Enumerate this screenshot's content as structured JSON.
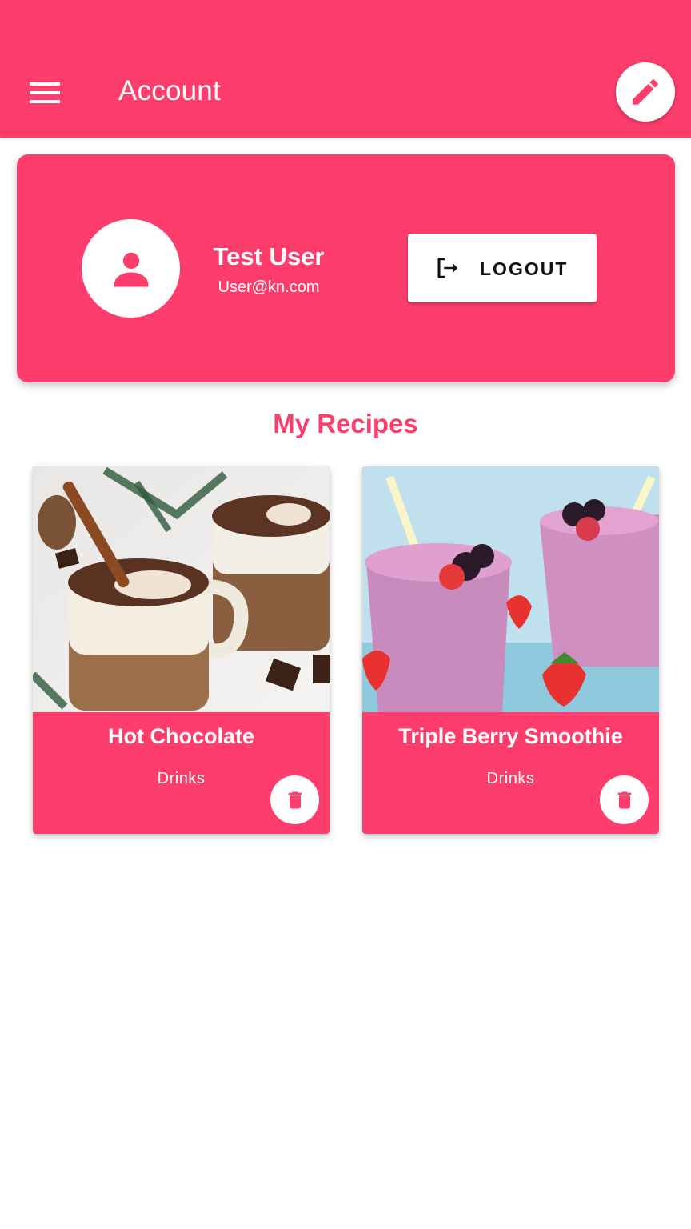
{
  "appbar": {
    "title": "Account",
    "menu_icon": "menu-icon",
    "edit_icon": "pencil-icon"
  },
  "profile": {
    "name": "Test User",
    "email": "User@kn.com",
    "avatar_icon": "person-icon",
    "logout_label": "LOGOUT",
    "logout_icon": "logout-icon"
  },
  "recipes": {
    "section_title": "My Recipes",
    "items": [
      {
        "title": "Hot Chocolate",
        "category": "Drinks",
        "image": "hot-chocolate-photo"
      },
      {
        "title": "Triple Berry Smoothie",
        "category": "Drinks",
        "image": "berry-smoothie-photo"
      }
    ],
    "delete_icon": "trash-icon"
  },
  "colors": {
    "primary": "#fd3e6d",
    "on_primary": "#ffffff"
  }
}
